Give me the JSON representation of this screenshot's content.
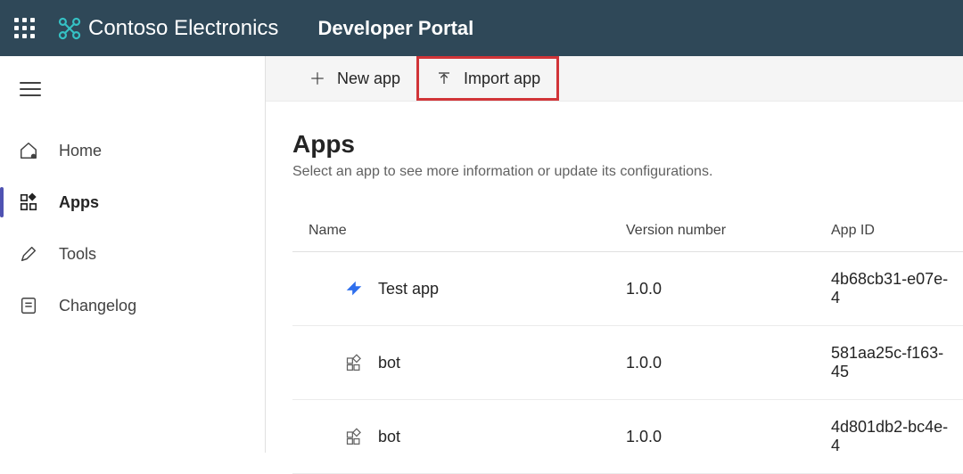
{
  "header": {
    "brand_name": "Contoso Electronics",
    "portal_label": "Developer Portal"
  },
  "sidebar": {
    "items": [
      {
        "label": "Home",
        "icon": "home-icon",
        "active": false
      },
      {
        "label": "Apps",
        "icon": "apps-icon",
        "active": true
      },
      {
        "label": "Tools",
        "icon": "pencil-icon",
        "active": false
      },
      {
        "label": "Changelog",
        "icon": "changelog-icon",
        "active": false
      }
    ]
  },
  "command_bar": {
    "new_app_label": "New app",
    "import_app_label": "Import app"
  },
  "page": {
    "title": "Apps",
    "subtitle": "Select an app to see more information or update its configurations."
  },
  "table": {
    "columns": {
      "name": "Name",
      "version": "Version number",
      "app_id": "App ID"
    },
    "rows": [
      {
        "icon": "arrow-app-icon",
        "name": "Test app",
        "version": "1.0.0",
        "app_id": "4b68cb31-e07e-4"
      },
      {
        "icon": "puzzle-icon",
        "name": "bot",
        "version": "1.0.0",
        "app_id": "581aa25c-f163-45"
      },
      {
        "icon": "puzzle-icon",
        "name": "bot",
        "version": "1.0.0",
        "app_id": "4d801db2-bc4e-4"
      }
    ]
  }
}
